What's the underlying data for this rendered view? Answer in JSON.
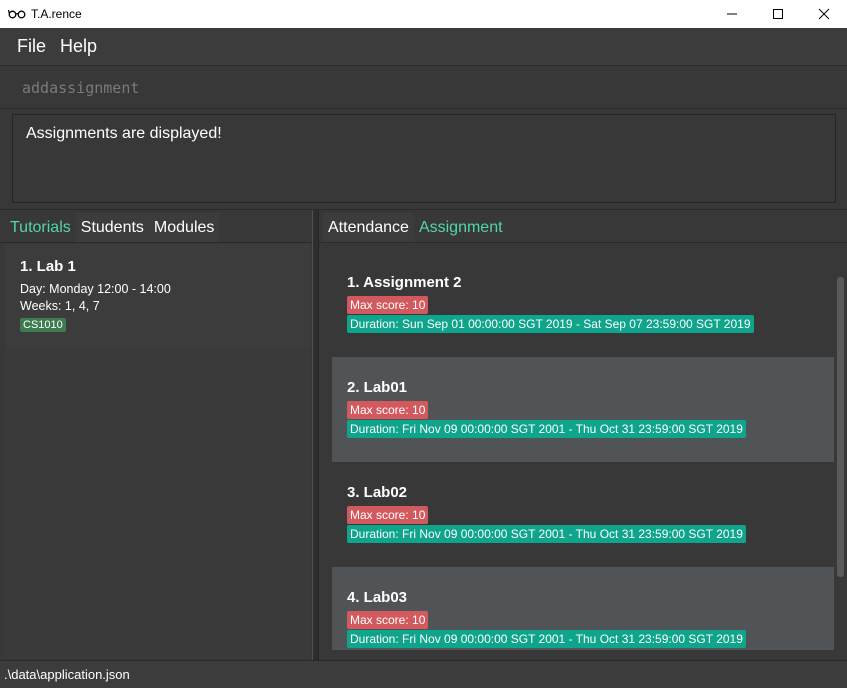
{
  "window": {
    "title": "T.A.rence",
    "app_icon": "glasses-icon",
    "controls": [
      "minimize-icon",
      "maximize-icon",
      "close-icon"
    ]
  },
  "menu": {
    "file_label": "File",
    "help_label": "Help"
  },
  "command": {
    "value": "addassignment"
  },
  "result": {
    "text": "Assignments are displayed!"
  },
  "left_tabs": {
    "tutorials": "Tutorials",
    "students": "Students",
    "modules": "Modules"
  },
  "tutorials": [
    {
      "title": "1.  Lab 1",
      "day": "Day: Monday 12:00 - 14:00",
      "weeks": "Weeks: 1, 4, 7",
      "tag": "CS1010"
    }
  ],
  "right_tabs": {
    "attendance": "Attendance",
    "assignment": "Assignment"
  },
  "assignments": [
    {
      "title": "1.  Assignment 2",
      "max_score": "Max score: 10",
      "duration": "Duration: Sun Sep 01 00:00:00 SGT 2019 - Sat Sep 07 23:59:00 SGT 2019"
    },
    {
      "title": "2.  Lab01",
      "max_score": "Max score: 10",
      "duration": "Duration: Fri Nov 09 00:00:00 SGT 2001 - Thu Oct 31 23:59:00 SGT 2019"
    },
    {
      "title": "3.  Lab02",
      "max_score": "Max score: 10",
      "duration": "Duration: Fri Nov 09 00:00:00 SGT 2001 - Thu Oct 31 23:59:00 SGT 2019"
    },
    {
      "title": "4.  Lab03",
      "max_score": "Max score: 10",
      "duration": "Duration: Fri Nov 09 00:00:00 SGT 2001 - Thu Oct 31 23:59:00 SGT 2019"
    }
  ],
  "status": {
    "path": ".\\data\\application.json"
  },
  "colors": {
    "accent_tab": "#53d6a7",
    "max_score_badge": "#d25a5f",
    "duration_badge": "#0fa58d",
    "module_tag": "#3e7b4f"
  }
}
